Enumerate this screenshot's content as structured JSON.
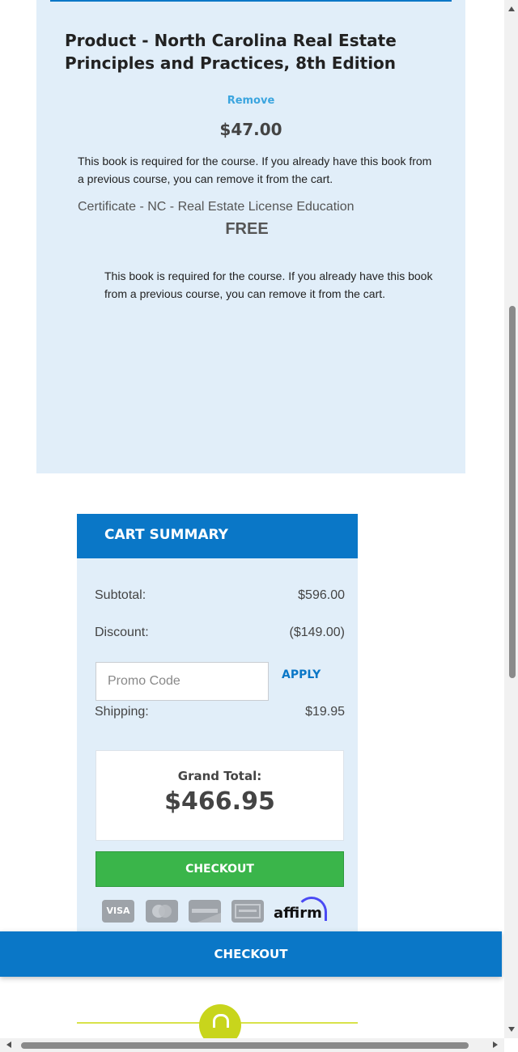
{
  "product": {
    "title": "Product - North Carolina Real Estate Principles and Practices, 8th Edition",
    "remove_label": "Remove",
    "price": "$47.00",
    "note": "This book is required for the course. If you already have this book from a previous course, you can remove it from the cart."
  },
  "certificate": {
    "name": "Certificate - NC - Real Estate License Education",
    "price": "FREE",
    "note": "This book is required for the course. If you already have this book from a previous course, you can remove it from the cart."
  },
  "cart_summary": {
    "title": "CART SUMMARY",
    "subtotal_label": "Subtotal:",
    "subtotal_value": "$596.00",
    "discount_label": "Discount:",
    "discount_value": "($149.00)",
    "promo_placeholder": "Promo Code",
    "apply_label": "APPLY",
    "shipping_label": "Shipping:",
    "shipping_value": "$19.95",
    "grand_total_label": "Grand Total:",
    "grand_total_value": "$466.95",
    "checkout_label": "CHECKOUT",
    "payment_icons": [
      "visa-icon",
      "mastercard-icon",
      "discover-icon",
      "american-express-icon",
      "affirm-logo"
    ],
    "visa_text": "VISA",
    "affirm_text": "affirm"
  },
  "sticky": {
    "checkout_label": "CHECKOUT"
  },
  "colors": {
    "brand_blue": "#0a77c7",
    "panel_bg": "#e1eef9",
    "checkout_green": "#3ab54a",
    "link_blue": "#3ba5df",
    "lock_yellow": "#c8d51c"
  }
}
